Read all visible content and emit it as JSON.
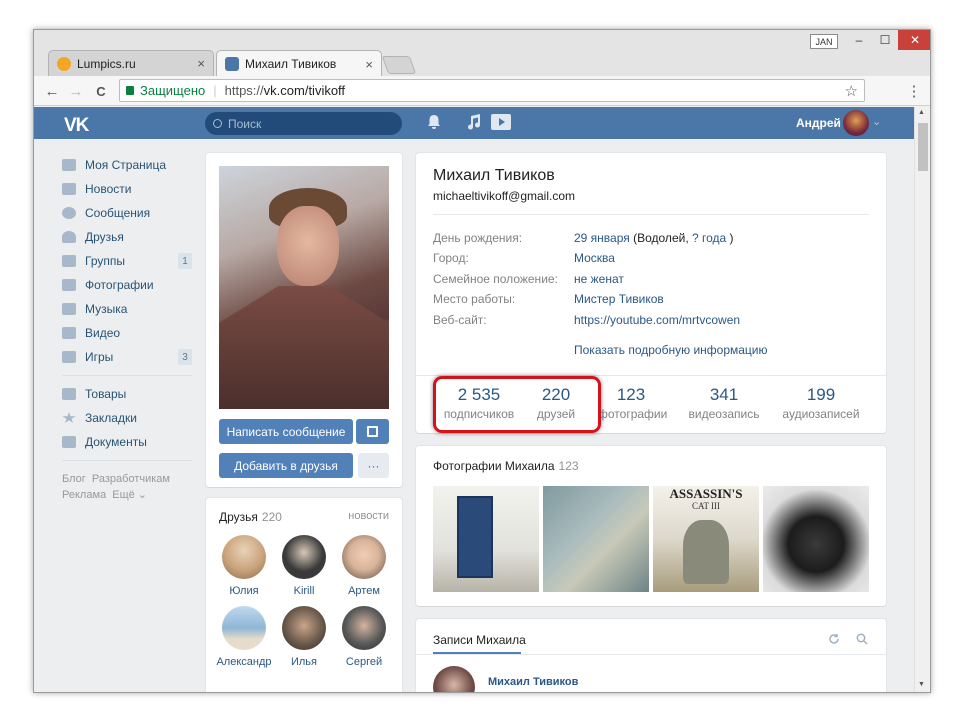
{
  "browser": {
    "tabs": [
      {
        "title": "Lumpics.ru",
        "close": "×",
        "favicon_color": "#f5a623"
      },
      {
        "title": "Михаил Тивиков",
        "close": "×",
        "favicon_color": "#4a76a8"
      }
    ],
    "user_badge": "JAN",
    "window_controls": {
      "minimize": "–",
      "maximize": "☐",
      "close": "✕"
    },
    "nav": {
      "back": "←",
      "forward": "→",
      "reload": "C"
    },
    "secure_label": "Защищено",
    "url_proto": "https://",
    "url_host": "vk.com/tivikoff",
    "star": "☆",
    "menu": "⋮"
  },
  "vk_header": {
    "logo": "VK",
    "search_placeholder": "Поиск",
    "user_name": "Андрей",
    "chevron": "⌄"
  },
  "left_nav": {
    "items": [
      {
        "label": "Моя Страница",
        "icon": "home-icon"
      },
      {
        "label": "Новости",
        "icon": "news-icon"
      },
      {
        "label": "Сообщения",
        "icon": "message-icon"
      },
      {
        "label": "Друзья",
        "icon": "friends-icon"
      },
      {
        "label": "Группы",
        "icon": "groups-icon",
        "count": "1"
      },
      {
        "label": "Фотографии",
        "icon": "camera-icon"
      },
      {
        "label": "Музыка",
        "icon": "music-icon"
      },
      {
        "label": "Видео",
        "icon": "video-icon"
      },
      {
        "label": "Игры",
        "icon": "games-icon",
        "count": "3"
      }
    ],
    "items2": [
      {
        "label": "Товары",
        "icon": "bag-icon"
      },
      {
        "label": "Закладки",
        "icon": "star-icon"
      },
      {
        "label": "Документы",
        "icon": "document-icon"
      }
    ],
    "footer": {
      "blog": "Блог",
      "developers": "Разработчикам",
      "ads": "Реклама",
      "more": "Ещё ⌄"
    }
  },
  "profile_left": {
    "write_message": "Написать сообщение",
    "add_friend": "Добавить в друзья",
    "more": "···",
    "gift_icon": "gift-icon"
  },
  "friends_block": {
    "title": "Друзья",
    "count": "220",
    "news_link": "новости",
    "friends": [
      {
        "name": "Юлия",
        "color": "#c9a27a"
      },
      {
        "name": "Kirill",
        "color": "#3a3a3a"
      },
      {
        "name": "Артем",
        "color": "#d9b49a"
      },
      {
        "name": "Александр",
        "color": "#8fb6d6"
      },
      {
        "name": "Илья",
        "color": "#6d5a4c"
      },
      {
        "name": "Сергей",
        "color": "#5a5a5a"
      }
    ]
  },
  "profile": {
    "name": "Михаил Тивиков",
    "email": "michaeltivikoff@gmail.com",
    "info": [
      {
        "key": "День рождения:",
        "value": "29 января",
        "extra1": " (",
        "link2": "Водолей",
        "extra2": ", ",
        "link3": "? года",
        "extra3": " )"
      },
      {
        "key": "Город:",
        "value": "Москва"
      },
      {
        "key": "Семейное положение:",
        "value": "не женат"
      },
      {
        "key": "Место работы:",
        "value": "Мистер Тивиков"
      },
      {
        "key": "Веб-сайт:",
        "value": "https://youtube.com/mrtvcowen"
      }
    ],
    "show_more": "Показать подробную информацию",
    "counters": [
      {
        "num": "2 535",
        "label": "подписчиков"
      },
      {
        "num": "220",
        "label": "друзей"
      },
      {
        "num": "123",
        "label": "фотографии"
      },
      {
        "num": "341",
        "label": "видеозапись"
      },
      {
        "num": "199",
        "label": "аудиозаписей"
      }
    ]
  },
  "photos_block": {
    "title": "Фотографии Михаила",
    "count": "123",
    "photo3_caption": "ASSASSIN'S",
    "photo3_sub": "CAT III"
  },
  "posts_block": {
    "tab": "Записи Михаила",
    "first_author": "Михаил Тивиков",
    "refresh_icon": "refresh-icon",
    "search_icon": "search-icon"
  },
  "scrollbar": {
    "up": "▲",
    "down": "▼"
  }
}
